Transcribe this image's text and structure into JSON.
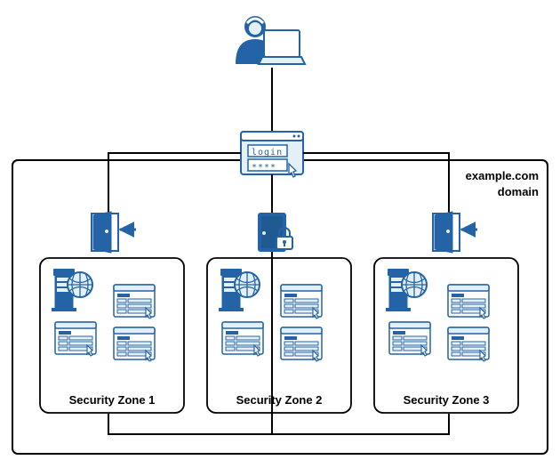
{
  "domain_line1": "example.com",
  "domain_line2": "domain",
  "login_label": "login",
  "login_mask": "****",
  "zones": [
    {
      "label": "Security Zone 1",
      "access": "open"
    },
    {
      "label": "Security Zone 2",
      "access": "locked"
    },
    {
      "label": "Security Zone 3",
      "access": "open"
    }
  ],
  "colors": {
    "stroke": "#2463a6",
    "light": "#e3f0fa",
    "dark": "#1f5a92"
  }
}
